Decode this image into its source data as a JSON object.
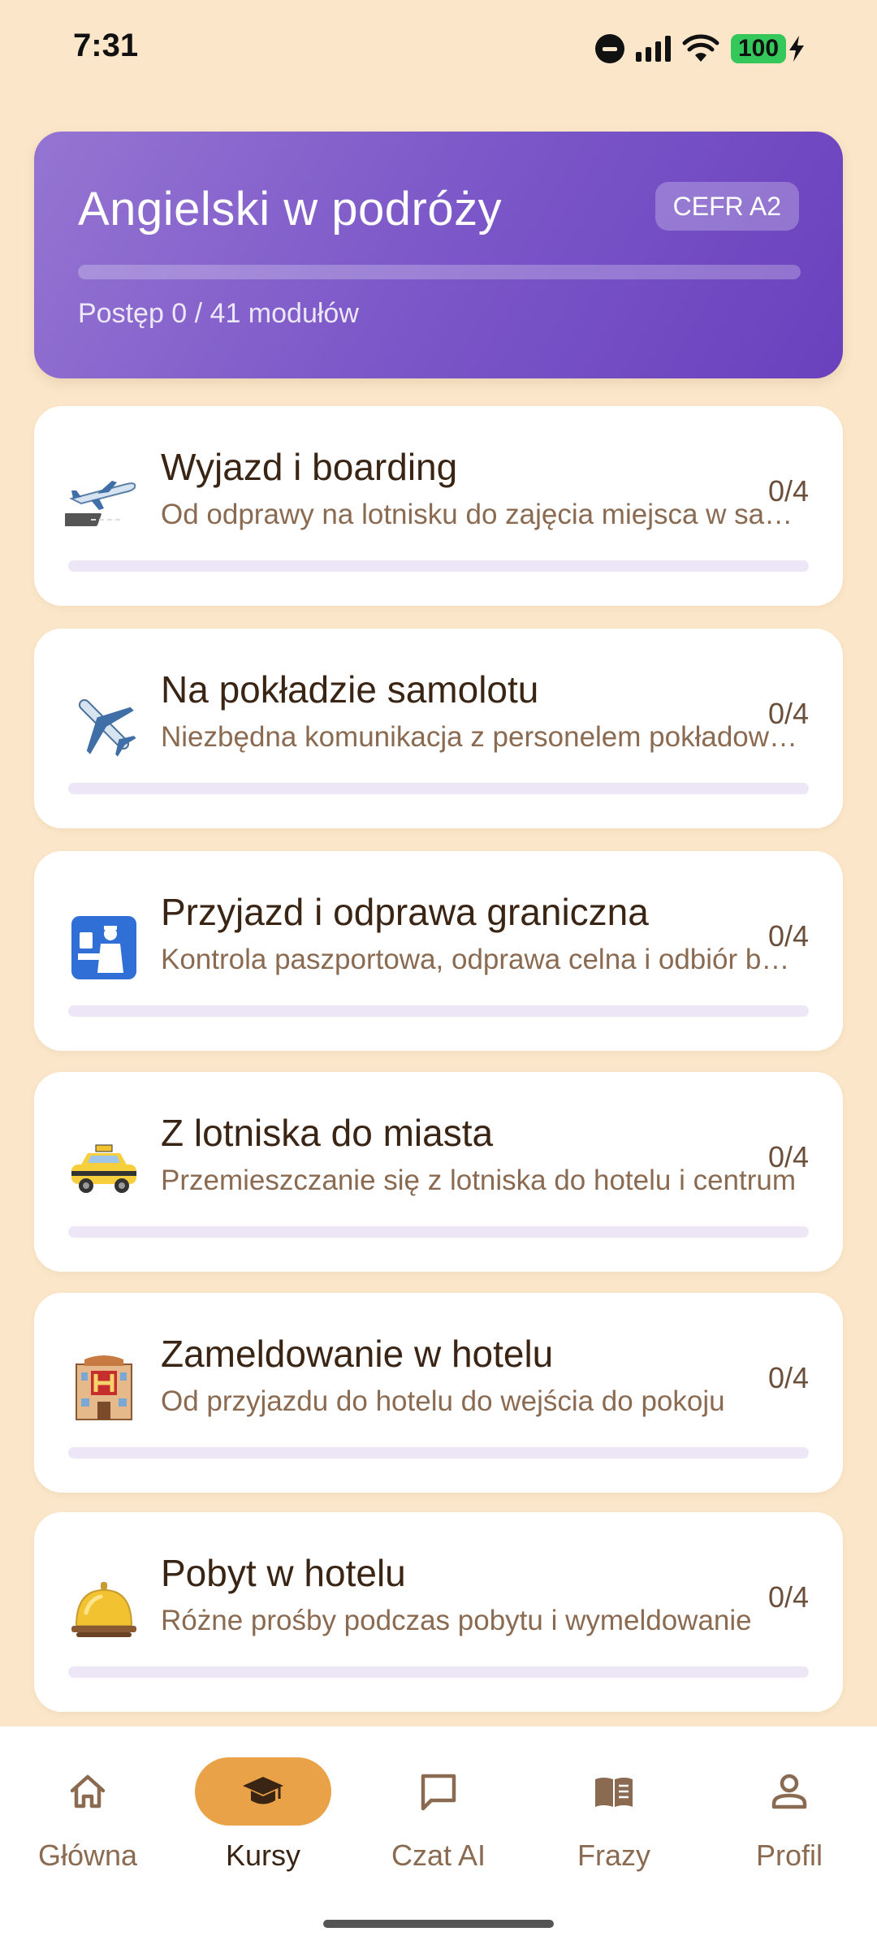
{
  "status_bar": {
    "time": "7:31",
    "battery": "100",
    "icons": [
      "do-not-disturb-icon",
      "signal-icon",
      "wifi-icon",
      "battery-icon",
      "charging-bolt-icon"
    ]
  },
  "course": {
    "title": "Angielski w podróży",
    "level": "CEFR A2",
    "progress_text": "Postęp 0 / 41 modułów",
    "progress_fraction": 0
  },
  "modules": [
    {
      "icon": "airplane-departure-icon",
      "title": "Wyjazd i boarding",
      "description": "Od odprawy na lotnisku do zajęcia miejsca w samolocie",
      "count": "0/4",
      "progress_fraction": 0
    },
    {
      "icon": "airplane-icon",
      "title": "Na pokładzie samolotu",
      "description": "Niezbędna komunikacja z personelem pokładowym",
      "count": "0/4",
      "progress_fraction": 0
    },
    {
      "icon": "passport-control-icon",
      "title": "Przyjazd i odprawa graniczna",
      "description": "Kontrola paszportowa, odprawa celna i odbiór bagażu",
      "count": "0/4",
      "progress_fraction": 0
    },
    {
      "icon": "taxi-icon",
      "title": "Z lotniska do miasta",
      "description": "Przemieszczanie się z lotniska do hotelu i centrum",
      "count": "0/4",
      "progress_fraction": 0
    },
    {
      "icon": "hotel-icon",
      "title": "Zameldowanie w hotelu",
      "description": "Od przyjazdu do hotelu do wejścia do pokoju",
      "count": "0/4",
      "progress_fraction": 0
    },
    {
      "icon": "bellhop-bell-icon",
      "title": "Pobyt w hotelu",
      "description": "Różne prośby podczas pobytu i wymeldowanie",
      "count": "0/4",
      "progress_fraction": 0
    }
  ],
  "nav": {
    "items": [
      {
        "label": "Główna",
        "icon": "home-icon",
        "active": false
      },
      {
        "label": "Kursy",
        "icon": "graduation-cap-icon",
        "active": true
      },
      {
        "label": "Czat AI",
        "icon": "chat-bubble-icon",
        "active": false
      },
      {
        "label": "Frazy",
        "icon": "book-icon",
        "active": false
      },
      {
        "label": "Profil",
        "icon": "person-icon",
        "active": false
      }
    ]
  },
  "colors": {
    "background": "#FBE6C9",
    "accent_purple": "#7B57C8",
    "active_nav": "#E9A247",
    "battery_green": "#34C759"
  }
}
